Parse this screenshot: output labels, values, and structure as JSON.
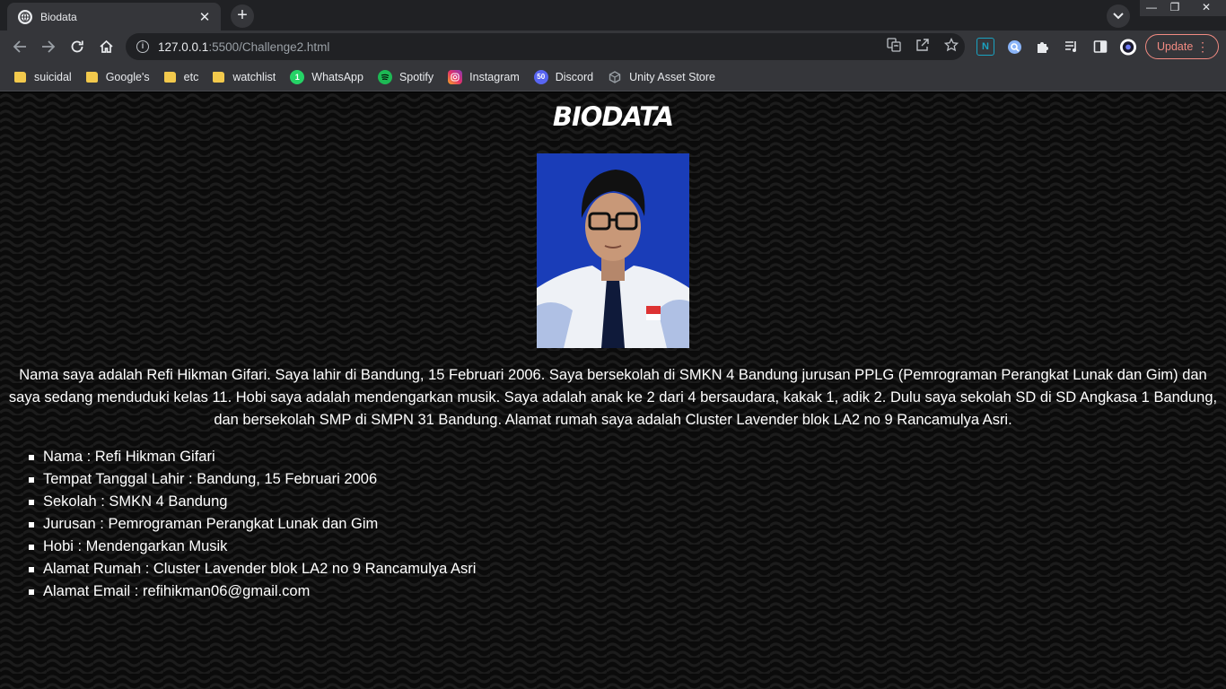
{
  "browser": {
    "tab": {
      "title": "Biodata",
      "close": "✕"
    },
    "new_tab": "+",
    "window_controls": {
      "minimize": "—",
      "restore": "❐",
      "close": "✕"
    },
    "url": {
      "host": "127.0.0.1",
      "rest": ":5500/Challenge2.html"
    },
    "update_label": "Update",
    "bookmarks": [
      {
        "label": "suicidal",
        "icon": "folder-icon"
      },
      {
        "label": "Google's",
        "icon": "folder-icon"
      },
      {
        "label": "etc",
        "icon": "folder-icon"
      },
      {
        "label": "watchlist",
        "icon": "folder-icon"
      },
      {
        "label": "WhatsApp",
        "icon": "whatsapp-icon",
        "color": "#25d366",
        "badge": "1"
      },
      {
        "label": "Spotify",
        "icon": "spotify-icon",
        "color": "#1db954"
      },
      {
        "label": "Instagram",
        "icon": "instagram-icon",
        "color": "#e1306c"
      },
      {
        "label": "Discord",
        "icon": "discord-icon",
        "color": "#5865f2",
        "badge": "50"
      },
      {
        "label": "Unity Asset Store",
        "icon": "unity-icon",
        "color": "#9aa0a6"
      }
    ]
  },
  "page": {
    "title": "BIODATA",
    "intro": "Nama saya adalah Refi Hikman Gifari. Saya lahir di Bandung, 15 Februari 2006. Saya bersekolah di SMKN 4 Bandung jurusan PPLG (Pemrograman Perangkat Lunak dan Gim) dan saya sedang menduduki kelas 11. Hobi saya adalah mendengarkan musik. Saya adalah anak ke 2 dari 4 bersaudara, kakak 1, adik 2. Dulu saya sekolah SD di SD Angkasa 1 Bandung, dan bersekolah SMP di SMPN 31 Bandung. Alamat rumah saya adalah Cluster Lavender blok LA2 no 9 Rancamulya Asri.",
    "facts": [
      "Nama : Refi Hikman Gifari",
      "Tempat Tanggal Lahir : Bandung, 15 Februari 2006",
      "Sekolah : SMKN 4 Bandung",
      "Jurusan : Pemrograman Perangkat Lunak dan Gim",
      "Hobi : Mendengarkan Musik",
      "Alamat Rumah : Cluster Lavender blok LA2 no 9 Rancamulya Asri",
      "Alamat Email : refihikman06@gmail.com"
    ]
  }
}
